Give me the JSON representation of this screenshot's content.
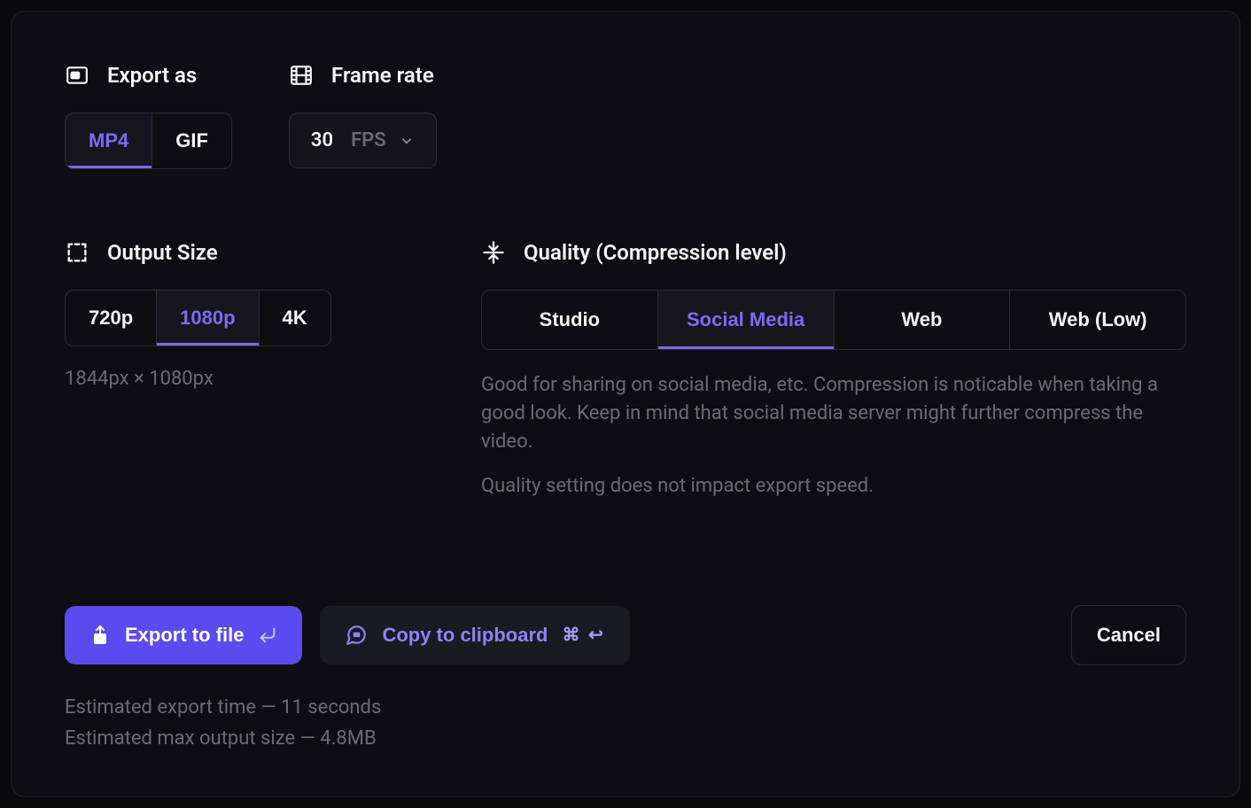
{
  "export_as": {
    "label": "Export as",
    "options": [
      "MP4",
      "GIF"
    ],
    "selected": "MP4"
  },
  "frame_rate": {
    "label": "Frame rate",
    "value": "30",
    "unit": "FPS"
  },
  "output_size": {
    "label": "Output Size",
    "options": [
      "720p",
      "1080p",
      "4K"
    ],
    "selected": "1080p",
    "dimensions": "1844px × 1080px"
  },
  "quality": {
    "label": "Quality (Compression level)",
    "options": [
      "Studio",
      "Social Media",
      "Web",
      "Web (Low)"
    ],
    "selected": "Social Media",
    "description": "Good for sharing on social media, etc. Compression is noticable when taking a good look. Keep in mind that social media server might further compress the video.",
    "note": "Quality setting does not impact export speed."
  },
  "actions": {
    "export_to_file": "Export to file",
    "copy_to_clipboard": "Copy to clipboard",
    "copy_shortcut": "⌘ ↩",
    "cancel": "Cancel"
  },
  "estimates": {
    "time": "Estimated export time — 11 seconds",
    "size": "Estimated max output size — 4.8MB"
  }
}
